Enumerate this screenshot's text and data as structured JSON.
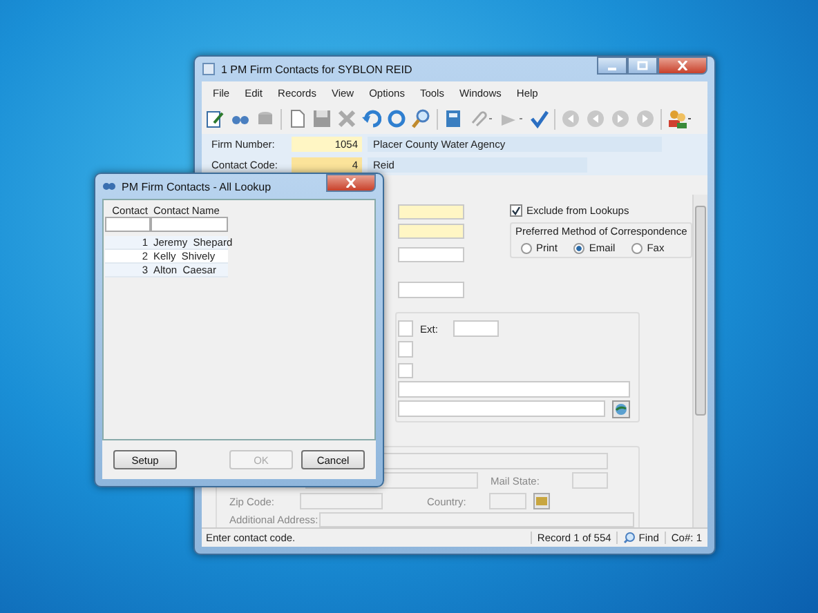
{
  "main_window": {
    "title": "1 PM Firm Contacts for SYBLON REID"
  },
  "menu": [
    "File",
    "Edit",
    "Records",
    "View",
    "Options",
    "Tools",
    "Windows",
    "Help"
  ],
  "header": [
    {
      "label": "Firm Number:",
      "code": "1054",
      "name": "Placer County Water Agency",
      "focused": false
    },
    {
      "label": "Contact Code:",
      "code": "4",
      "name": "Reid",
      "focused": true
    }
  ],
  "exclude_from_lookups": {
    "label": "Exclude from Lookups",
    "checked": true
  },
  "correspondence": {
    "title": "Preferred Method of Correspondence",
    "options": [
      {
        "label": "Print",
        "selected": false
      },
      {
        "label": "Email",
        "selected": true
      },
      {
        "label": "Fax",
        "selected": false
      }
    ]
  },
  "phone": {
    "ext_label": "Ext:"
  },
  "address": {
    "mail_state_label": "Mail State:",
    "zip_label": "Zip Code:",
    "country_label": "Country:",
    "additional_label": "Additional Address:"
  },
  "status_bar": {
    "message": "Enter contact code.",
    "record": "Record 1 of 554",
    "find": "Find",
    "company": "Co#: 1"
  },
  "lookup": {
    "title": "PM Firm Contacts - All Lookup",
    "columns": [
      "Contact",
      "Contact Name"
    ],
    "rows": [
      {
        "contact": "1",
        "name": "Jeremy  Shepard",
        "selected": false
      },
      {
        "contact": "2",
        "name": "Kelly  Shively",
        "selected": false
      },
      {
        "contact": "3",
        "name": "Alton  Caesar",
        "selected": false
      }
    ],
    "buttons": [
      {
        "label": "Setup",
        "disabled": false
      },
      {
        "label": "OK",
        "disabled": true
      },
      {
        "label": "Cancel",
        "disabled": false
      }
    ]
  }
}
